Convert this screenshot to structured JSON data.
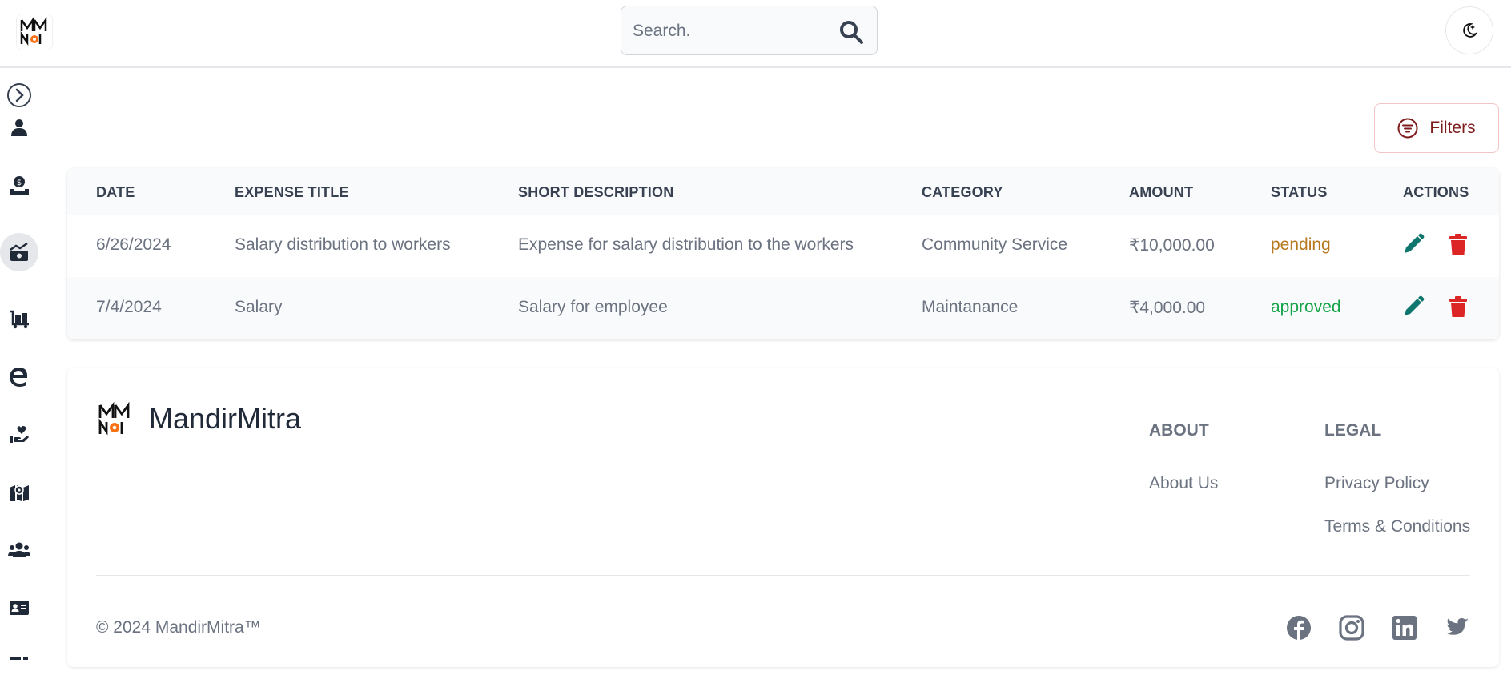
{
  "header": {
    "search_placeholder": "Search.",
    "icons": {
      "logo": "mandirmitra-logo",
      "search": "search-icon",
      "theme": "moon-icon"
    }
  },
  "sidebar": {
    "items": [
      {
        "icon": "chevron-right-icon",
        "active": false
      },
      {
        "icon": "user-icon",
        "active": false
      },
      {
        "icon": "donation-icon",
        "active": false
      },
      {
        "icon": "expense-icon",
        "active": true
      },
      {
        "icon": "luggage-cart-icon",
        "active": false
      },
      {
        "icon": "edge-icon",
        "active": false
      },
      {
        "icon": "hand-heart-icon",
        "active": false
      },
      {
        "icon": "map-icon",
        "active": false
      },
      {
        "icon": "users-icon",
        "active": false
      },
      {
        "icon": "id-card-icon",
        "active": false
      }
    ]
  },
  "toolbar": {
    "filters_label": "Filters"
  },
  "table": {
    "columns": [
      "DATE",
      "EXPENSE TITLE",
      "SHORT DESCRIPTION",
      "CATEGORY",
      "AMOUNT",
      "STATUS",
      "ACTIONS"
    ],
    "rows": [
      {
        "date": "6/26/2024",
        "title": "Salary distribution to workers",
        "description": "Expense for salary distribution to the workers",
        "category": "Community Service",
        "amount": "₹10,000.00",
        "status": "pending"
      },
      {
        "date": "7/4/2024",
        "title": "Salary",
        "description": "Salary for employee",
        "category": "Maintanance",
        "amount": "₹4,000.00",
        "status": "approved"
      }
    ]
  },
  "footer": {
    "brand": "MandirMitra",
    "about_heading": "ABOUT",
    "about_links": [
      "About Us"
    ],
    "legal_heading": "LEGAL",
    "legal_links": [
      "Privacy Policy",
      "Terms & Conditions"
    ],
    "copyright": "© 2024 MandirMitra™",
    "social": [
      "facebook-icon",
      "instagram-icon",
      "linkedin-icon",
      "twitter-icon"
    ]
  },
  "colors": {
    "pending": "#b7791f",
    "approved": "#16a34a",
    "edit": "#0f766e",
    "delete": "#dc2626",
    "filters_border": "#f3c4c4"
  }
}
